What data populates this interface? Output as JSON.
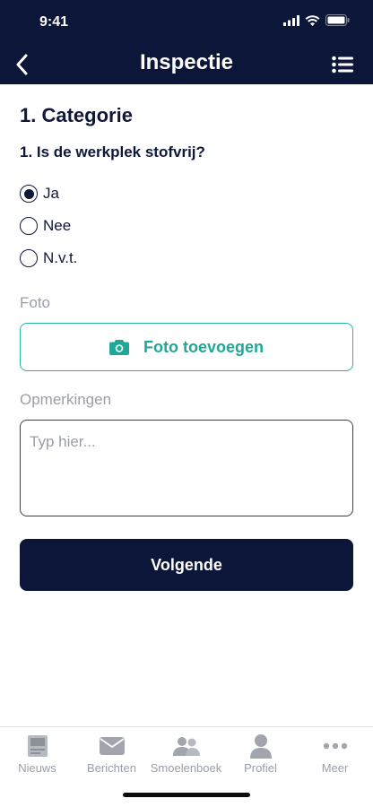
{
  "status": {
    "time": "9:41"
  },
  "nav": {
    "title": "Inspectie"
  },
  "section": {
    "title": "1. Categorie"
  },
  "question": {
    "text": "1. Is de werkplek stofvrij?",
    "options": [
      {
        "label": "Ja",
        "selected": true
      },
      {
        "label": "Nee",
        "selected": false
      },
      {
        "label": "N.v.t.",
        "selected": false
      }
    ]
  },
  "photo": {
    "label": "Foto",
    "button": "Foto toevoegen"
  },
  "remarks": {
    "label": "Opmerkingen",
    "placeholder": "Typ hier..."
  },
  "next_button": "Volgende",
  "tabs": [
    {
      "label": "Nieuws",
      "icon": "newspaper-icon"
    },
    {
      "label": "Berichten",
      "icon": "envelope-icon"
    },
    {
      "label": "Smoelenboek",
      "icon": "people-icon"
    },
    {
      "label": "Profiel",
      "icon": "person-icon"
    },
    {
      "label": "Meer",
      "icon": "more-icon"
    }
  ],
  "colors": {
    "navy": "#0c1638",
    "teal": "#1fa898",
    "muted": "#9a9ea8"
  }
}
